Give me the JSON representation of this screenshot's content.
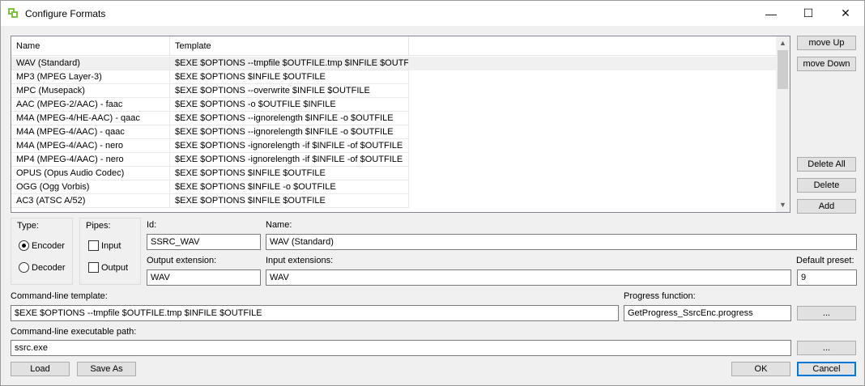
{
  "window": {
    "title": "Configure Formats"
  },
  "titlebar_controls": {
    "minimize": "—",
    "maximize": "☐",
    "close": "✕"
  },
  "side_buttons": {
    "move_up": "move Up",
    "move_down": "move Down",
    "delete_all": "Delete All",
    "delete": "Delete",
    "add": "Add"
  },
  "table": {
    "columns": [
      "Name",
      "Template"
    ],
    "rows": [
      {
        "name": "WAV (Standard)",
        "template": "$EXE $OPTIONS --tmpfile $OUTFILE.tmp $INFILE $OUTF..."
      },
      {
        "name": "MP3 (MPEG Layer-3)",
        "template": "$EXE $OPTIONS $INFILE $OUTFILE"
      },
      {
        "name": "MPC (Musepack)",
        "template": "$EXE $OPTIONS --overwrite $INFILE $OUTFILE"
      },
      {
        "name": "AAC (MPEG-2/AAC) - faac",
        "template": "$EXE $OPTIONS -o $OUTFILE $INFILE"
      },
      {
        "name": "M4A (MPEG-4/HE-AAC) - qaac",
        "template": "$EXE $OPTIONS --ignorelength $INFILE -o $OUTFILE"
      },
      {
        "name": "M4A (MPEG-4/AAC) - qaac",
        "template": "$EXE $OPTIONS --ignorelength $INFILE -o $OUTFILE"
      },
      {
        "name": "M4A (MPEG-4/AAC) - nero",
        "template": "$EXE $OPTIONS -ignorelength -if $INFILE -of $OUTFILE"
      },
      {
        "name": "MP4 (MPEG-4/AAC) - nero",
        "template": "$EXE $OPTIONS -ignorelength -if $INFILE -of $OUTFILE"
      },
      {
        "name": "OPUS (Opus Audio Codec)",
        "template": "$EXE $OPTIONS $INFILE $OUTFILE"
      },
      {
        "name": "OGG (Ogg Vorbis)",
        "template": "$EXE $OPTIONS $INFILE -o $OUTFILE"
      },
      {
        "name": "AC3 (ATSC A/52)",
        "template": "$EXE $OPTIONS $INFILE $OUTFILE"
      }
    ]
  },
  "type_group": {
    "label": "Type:",
    "encoder": "Encoder",
    "decoder": "Decoder"
  },
  "pipes_group": {
    "label": "Pipes:",
    "input": "Input",
    "output": "Output"
  },
  "id": {
    "label": "Id:",
    "value": "SSRC_WAV"
  },
  "name": {
    "label": "Name:",
    "value": "WAV (Standard)"
  },
  "output_extension": {
    "label": "Output extension:",
    "value": "WAV"
  },
  "input_extensions": {
    "label": "Input extensions:",
    "value": "WAV"
  },
  "default_preset": {
    "label": "Default preset:",
    "value": "9"
  },
  "command_template": {
    "label": "Command-line template:",
    "value": "$EXE $OPTIONS --tmpfile $OUTFILE.tmp $INFILE $OUTFILE"
  },
  "progress_function": {
    "label": "Progress function:",
    "value": "GetProgress_SsrcEnc.progress",
    "browse": "..."
  },
  "exe_path": {
    "label": "Command-line executable path:",
    "value": "ssrc.exe",
    "browse": "..."
  },
  "footer": {
    "load": "Load",
    "save_as": "Save As",
    "ok": "OK",
    "cancel": "Cancel"
  }
}
